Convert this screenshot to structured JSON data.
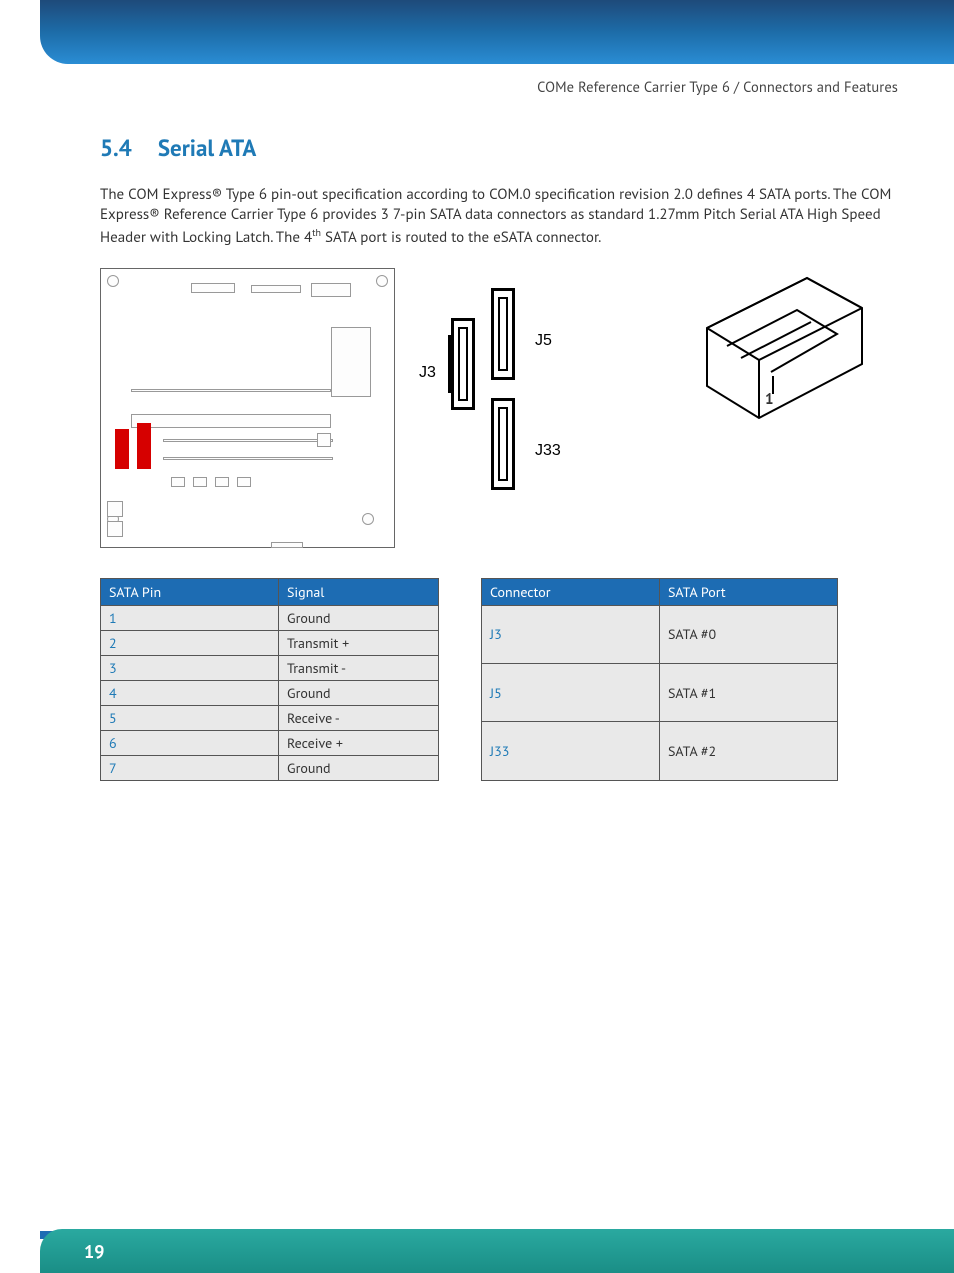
{
  "header": {
    "running_title": "COMe Reference Carrier Type 6 / Connectors and Features"
  },
  "section": {
    "number": "5.4",
    "title": "Serial ATA",
    "paragraph_pre": "The COM Express® Type 6 pin-out specification according to COM.0 specification revision 2.0 defines 4 SATA ports. The COM Express® Reference Carrier Type 6 provides 3 7-pin SATA data connectors as standard 1.27mm Pitch Serial ATA High Speed Header with Locking Latch. The 4",
    "paragraph_sup": "th",
    "paragraph_post": " SATA port is routed to the eSATA connector."
  },
  "midlabels": {
    "j3": "J3",
    "j5": "J5",
    "j33": "J33"
  },
  "pin1_label": "1",
  "table_pins": {
    "headers": [
      "SATA Pin",
      "Signal"
    ],
    "rows": [
      [
        "1",
        "Ground"
      ],
      [
        "2",
        "Transmit +"
      ],
      [
        "3",
        "Transmit -"
      ],
      [
        "4",
        "Ground"
      ],
      [
        "5",
        "Receive -"
      ],
      [
        "6",
        "Receive +"
      ],
      [
        "7",
        "Ground"
      ]
    ]
  },
  "table_ports": {
    "headers": [
      "Connector",
      "SATA Port"
    ],
    "rows": [
      [
        "J3",
        "SATA #0"
      ],
      [
        "J5",
        "SATA #1"
      ],
      [
        "J33",
        "SATA #2"
      ]
    ]
  },
  "page_number": "19"
}
